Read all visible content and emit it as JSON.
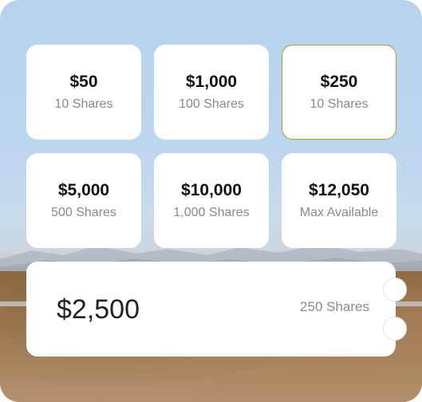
{
  "tiles": [
    {
      "amount": "$50",
      "shares": "10 Shares",
      "selected": false
    },
    {
      "amount": "$1,000",
      "shares": "100 Shares",
      "selected": false
    },
    {
      "amount": "$250",
      "shares": "10 Shares",
      "selected": true
    },
    {
      "amount": "$5,000",
      "shares": "500 Shares",
      "selected": false
    },
    {
      "amount": "$10,000",
      "shares": "1,000 Shares",
      "selected": false
    },
    {
      "amount": "$12,050",
      "shares": "Max Available",
      "selected": false
    }
  ],
  "custom": {
    "value": "$2,500",
    "shares": "250 Shares"
  },
  "colors": {
    "selected_border": "#b8953f",
    "amount_text": "#111111",
    "shares_text": "#8a8a8a"
  }
}
